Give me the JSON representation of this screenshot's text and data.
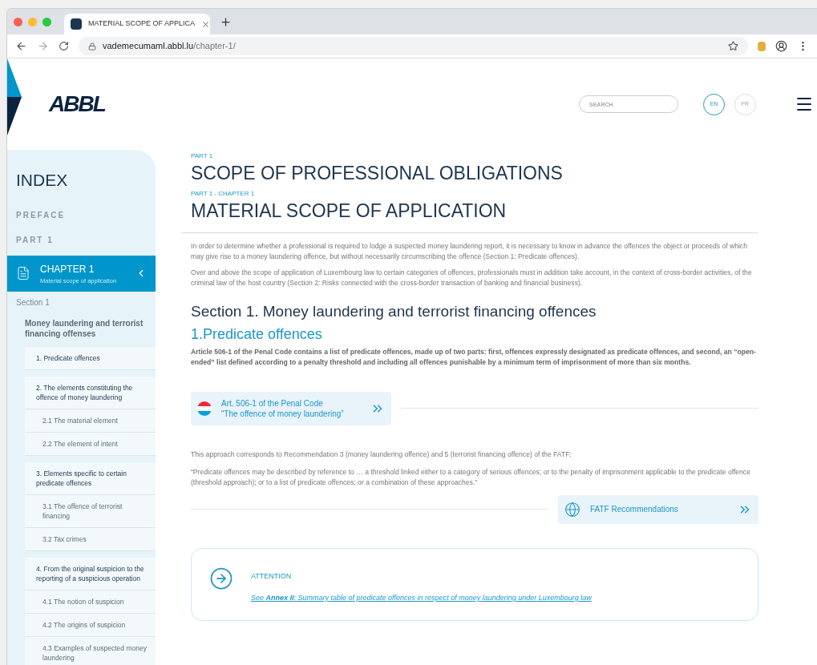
{
  "browser": {
    "tab_title": "MATERIAL SCOPE OF APPLICA",
    "url_host": "vademecumaml.abbl.lu",
    "url_path": "/chapter-1/"
  },
  "header": {
    "logo": "ABBL",
    "search": {
      "placeholder": "SEARCH"
    },
    "languages": [
      {
        "label": "EN",
        "selected": true
      },
      {
        "label": "FR",
        "selected": false
      }
    ]
  },
  "sidebar": {
    "title": "INDEX",
    "items": [
      {
        "kind": "part",
        "label": "PREFACE"
      },
      {
        "kind": "part",
        "label": "PART 1"
      },
      {
        "kind": "chapter",
        "label": "CHAPTER 1",
        "subtitle": "Material scope of application",
        "selected": true
      },
      {
        "kind": "section",
        "label": "Section 1",
        "children": [
          {
            "label": "Money laundering and terrorist financing offenses",
            "children": [
              {
                "label": "1. Predicate offences"
              },
              {
                "label": "2. The elements constituting the offence of money laundering",
                "children": [
                  {
                    "label": "2.1 The material element"
                  },
                  {
                    "label": "2.2 The element of intent"
                  }
                ]
              },
              {
                "label": "3. Elements specific to certain predicate offences",
                "children": [
                  {
                    "label": "3.1 The offence of terrorist financing"
                  },
                  {
                    "label": "3.2 Tax crimes"
                  }
                ]
              },
              {
                "label": "4. From the original suspicion to the reporting of a suspicious operation",
                "children": [
                  {
                    "label": "4.1 The notion of suspicion"
                  },
                  {
                    "label": "4.2 The origins of suspicion"
                  },
                  {
                    "label": "4.3 Examples of suspected money laundering"
                  }
                ]
              }
            ]
          }
        ]
      }
    ]
  },
  "content": {
    "part_label": "PART 1",
    "part_title": "SCOPE OF PROFESSIONAL OBLIGATIONS",
    "chapter_label": "PART 1 - CHAPTER 1",
    "chapter_title": "MATERIAL SCOPE OF APPLICATION",
    "intro": [
      "In order to determine whether a professional is required to lodge a suspected money laundering report, it is necessary to know in advance the offences the object or proceeds of which may give rise to a money laundering offence, but without necessarily circumscribing the offence (Section 1: Predicate offences).",
      "Over and above the scope of application of Luxembourg law to certain categories of offences, professionals must in addition take account, in the context of cross-border activities, of the criminal law of the host country (Section 2: Risks connected with the cross-border transaction of banking and financial business)."
    ],
    "section_title": "Section 1. Money laundering and terrorist financing offences",
    "subsection_title": "1.Predicate offences",
    "lead": "Article 506-1 of the Penal Code contains a list of predicate offences, made up of two parts: first, offences expressly designated as predicate offences, and second, an “open-ended” list defined according to a penalty threshold and including all offences punishable by a minimum term of imprisonment of more than six months.",
    "link_1": {
      "kind": "flag",
      "lines": [
        "Art. 506-1 of the Penal Code",
        "“The offence of money laundering”"
      ]
    },
    "paragraphs": [
      "This approach corresponds to Recommendation 3 (money laundering offence) and 5 (terrorist financing offence) of the FATF:",
      "“Predicate offences may be described by reference to … a threshold linked either to a category of serious offences; or to the penalty of imprisonment applicable to the predicate offence (threshold approach); or to a list of predicate offences; or a combination of these approaches.”"
    ],
    "link_2": {
      "kind": "globe",
      "lines": [
        "FATF Recommendations"
      ]
    },
    "attention": {
      "title": "ATTENTION",
      "text": "See **Annex II**: Summary table of predicate offences in respect of money laundering under Luxembourg law"
    }
  }
}
